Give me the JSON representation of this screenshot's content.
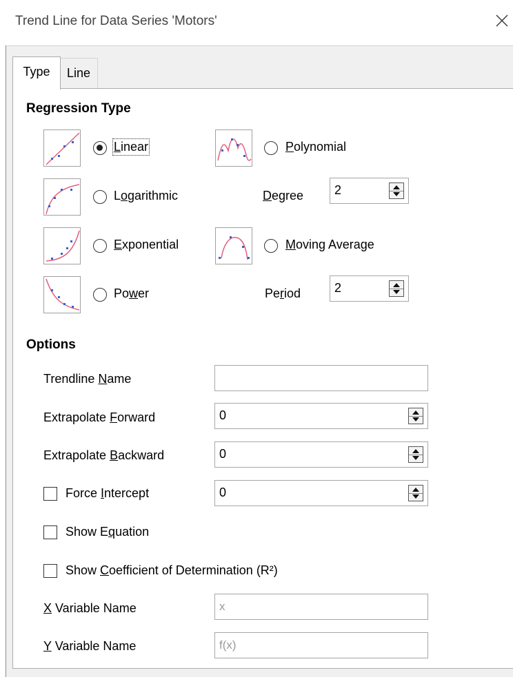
{
  "window": {
    "title": "Trend Line for Data Series 'Motors'"
  },
  "tabs": [
    {
      "label": "Type",
      "selected": true
    },
    {
      "label": "Line",
      "selected": false
    }
  ],
  "regression": {
    "heading": "Regression Type",
    "selected": "Linear",
    "types": [
      {
        "pre": "",
        "mn": "L",
        "post": "inear",
        "icon": "linear-trend-icon",
        "checked": true
      },
      {
        "pre": "L",
        "mn": "o",
        "post": "garithmic",
        "icon": "logarithmic-trend-icon",
        "checked": false
      },
      {
        "pre": "",
        "mn": "E",
        "post": "xponential",
        "icon": "exponential-trend-icon",
        "checked": false
      },
      {
        "pre": "Po",
        "mn": "w",
        "post": "er",
        "icon": "power-trend-icon",
        "checked": false
      },
      {
        "pre": "",
        "mn": "P",
        "post": "olynomial",
        "icon": "polynomial-trend-icon",
        "checked": false
      },
      {
        "pre": "",
        "mn": "M",
        "post": "oving Average",
        "icon": "moving-average-trend-icon",
        "checked": false
      }
    ],
    "degree": {
      "pre": "",
      "mn": "D",
      "post": "egree",
      "value": "2"
    },
    "period": {
      "pre": "Pe",
      "mn": "r",
      "post": "iod",
      "value": "2"
    }
  },
  "options": {
    "heading": "Options",
    "trendline_name": {
      "pre": "Trendline ",
      "mn": "N",
      "post": "ame",
      "value": ""
    },
    "extrapolate_forward": {
      "pre": "Extrapolate ",
      "mn": "F",
      "post": "orward",
      "value": "0"
    },
    "extrapolate_backward": {
      "pre": "Extrapolate ",
      "mn": "B",
      "post": "ackward",
      "value": "0"
    },
    "force_intercept": {
      "pre": "Force ",
      "mn": "I",
      "post": "ntercept",
      "checked": false,
      "value": "0"
    },
    "show_equation": {
      "pre": "Show E",
      "mn": "q",
      "post": "uation",
      "checked": false
    },
    "show_r2": {
      "pre": "Show ",
      "mn": "C",
      "post": "oefficient of Determination (R²)",
      "checked": false
    },
    "x_variable": {
      "pre": "",
      "mn": "X",
      "post": " Variable Name",
      "placeholder": "x"
    },
    "y_variable": {
      "pre": "",
      "mn": "Y",
      "post": " Variable Name",
      "placeholder": "f(x)"
    }
  },
  "colors": {
    "curve": "#e0607e",
    "points": "#3a5fcd",
    "panel_bg": "#ffffff",
    "dialog_bg": "#f0f0f0"
  }
}
